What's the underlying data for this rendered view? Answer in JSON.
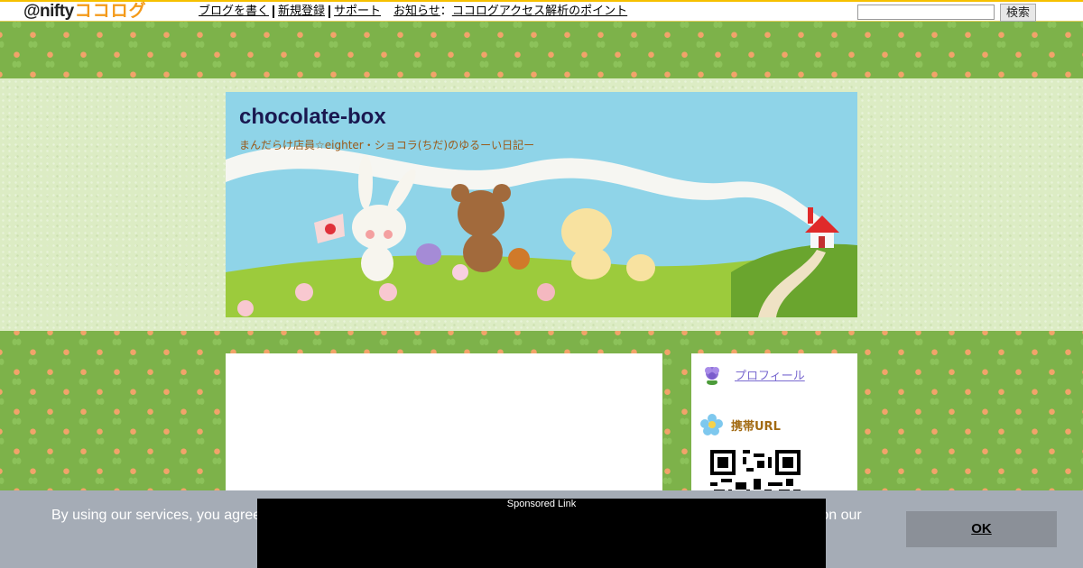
{
  "topbar": {
    "logo_prefix": "@nifty",
    "logo_suffix": "ココログ",
    "links": [
      "ブログを書く",
      "新規登録",
      "サポート"
    ],
    "notice_label": "お知らせ",
    "notice_colon": "：",
    "notice_link": "ココログアクセス解析のポイント",
    "search_placeholder": "",
    "search_button": "検索"
  },
  "header": {
    "title": "chocolate-box",
    "description": "まんだらけ店員☆eighter・ショコラ(ちだ)のゆるーい日記ー"
  },
  "sidebar": {
    "profile_link": "プロフィール",
    "mobile_url_heading": "携帯URL",
    "icons": [
      "purple-flower-icon",
      "blue-flower-icon"
    ]
  },
  "cookie": {
    "text_left": "By using our services, you agree",
    "text_right": "ce on our",
    "ok_label": "OK"
  },
  "ad": {
    "label": "Sponsored Link"
  },
  "colors": {
    "nifty_accent": "#f6c000",
    "cocolog_orange": "#f49a1a",
    "title_navy": "#1a1850",
    "desc_brown": "#9a5a1a",
    "cookie_bg": "#a5acb6"
  }
}
